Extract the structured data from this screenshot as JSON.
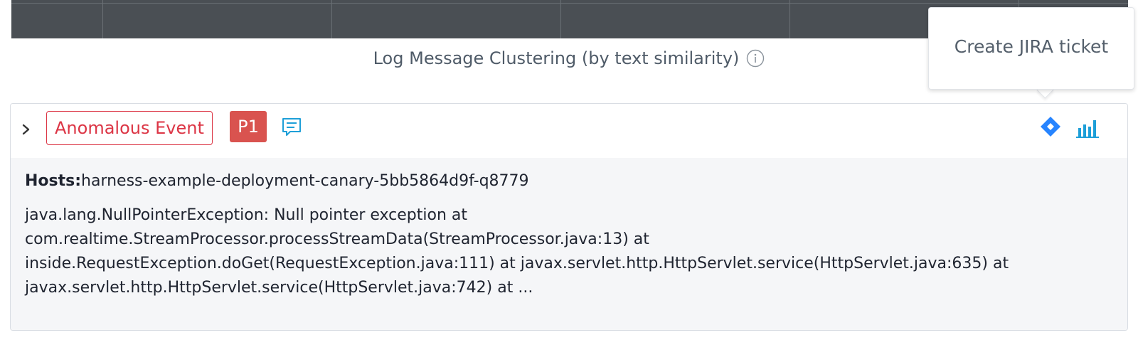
{
  "section": {
    "title": "Log Message Clustering (by text similarity)",
    "info_icon": "info-icon"
  },
  "event": {
    "badge_label": "Anomalous Event",
    "priority_label": "P1",
    "comment_icon": "comment-icon",
    "jira_icon": "jira-icon",
    "chart_icon": "bar-chart-icon",
    "hosts_label": "Hosts:",
    "hosts_value": "harness-example-deployment-canary-5bb5864d9f-q8779",
    "stack_lines": [
      "java.lang.NullPointerException: Null pointer exception  at",
      "com.realtime.StreamProcessor.processStreamData(StreamProcessor.java:13)  at",
      "inside.RequestException.doGet(RequestException.java:111)  at javax.servlet.http.HttpServlet.service(HttpServlet.java:635)  at",
      "javax.servlet.http.HttpServlet.service(HttpServlet.java:742)  at ..."
    ]
  },
  "tooltip": {
    "text": "Create JIRA ticket"
  },
  "colors": {
    "anomalous": "#dc3545",
    "priority_bg": "#d9534f",
    "icon_blue": "#1e9fd8",
    "jira_blue": "#2684ff",
    "table_bg": "#4a4f54"
  }
}
